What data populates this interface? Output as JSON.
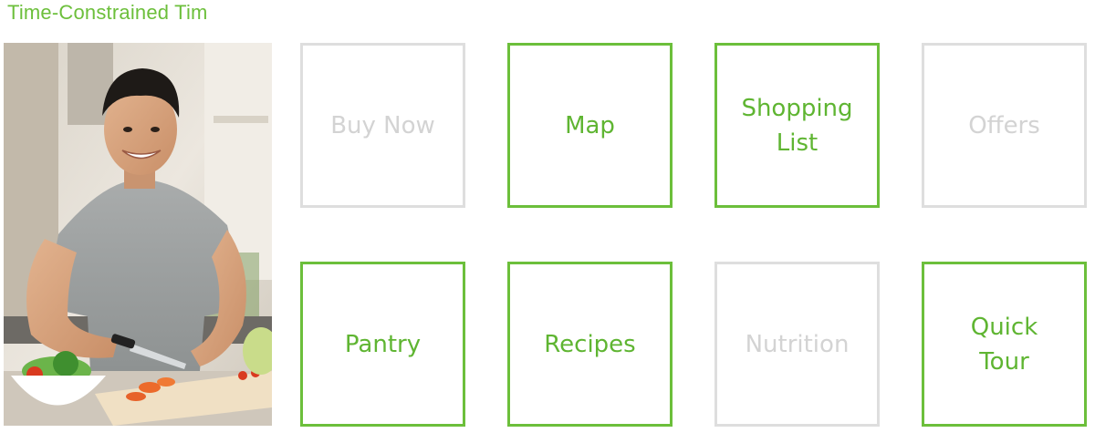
{
  "persona": {
    "title": "Time-Constrained Tim",
    "accent_color": "#6cbf3b"
  },
  "photo": {
    "subject": "man-cooking-photo"
  },
  "tiles": [
    {
      "label": "Buy Now",
      "state": "disabled"
    },
    {
      "label": "Map",
      "state": "active"
    },
    {
      "label": "Shopping\nList",
      "state": "active"
    },
    {
      "label": "Offers",
      "state": "disabled"
    },
    {
      "label": "Pantry",
      "state": "active"
    },
    {
      "label": "Recipes",
      "state": "active"
    },
    {
      "label": "Nutrition",
      "state": "disabled"
    },
    {
      "label": "Quick\nTour",
      "state": "active"
    }
  ],
  "colors": {
    "active_border": "#6cbf3b",
    "active_text": "#5fb532",
    "disabled_border": "#dedede",
    "disabled_text": "#d3d3d3"
  }
}
